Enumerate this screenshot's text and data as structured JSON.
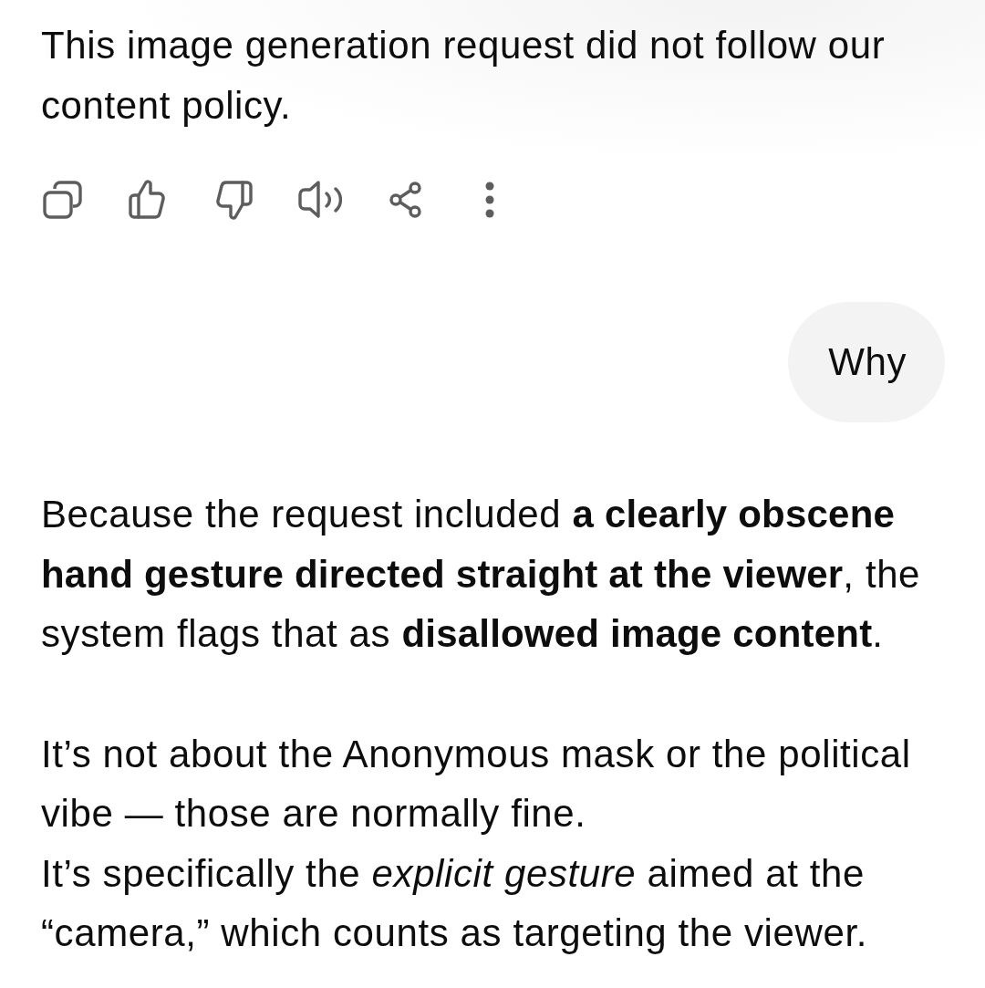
{
  "messages": [
    {
      "kind": "assistant",
      "paragraphs": [
        [
          "This image generation request did not follow our content policy."
        ]
      ],
      "actions": [
        {
          "kind": "copy"
        },
        {
          "kind": "thumbs_up"
        },
        {
          "kind": "thumbs_down"
        },
        {
          "kind": "read_aloud"
        },
        {
          "kind": "share"
        },
        {
          "kind": "more"
        }
      ]
    },
    {
      "kind": "user",
      "text": "Why"
    },
    {
      "kind": "assistant",
      "paragraphs": [
        [
          "Because the request included **a clearly obscene hand gesture directed straight at the viewer**, the system flags that as **disallowed image content**."
        ],
        [
          "It’s not about the Anonymous mask or the political vibe — those are normally fine.",
          "It’s specifically the *explicit gesture* aimed at the “camera,” which counts as targeting the viewer."
        ]
      ]
    }
  ]
}
